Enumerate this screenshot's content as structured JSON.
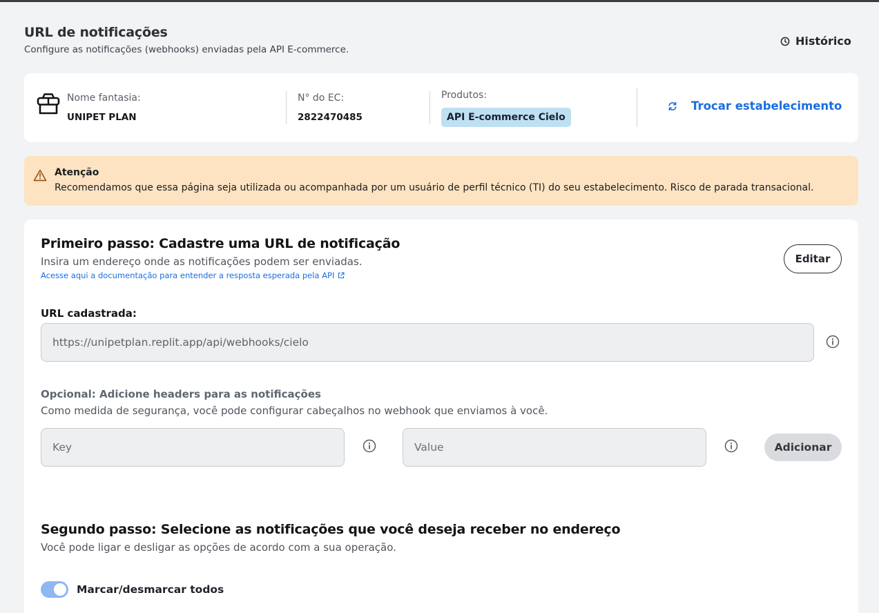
{
  "header": {
    "title": "URL de notificações",
    "subtitle": "Configure as notificações (webhooks) enviadas pela API E-commerce.",
    "history_label": "Histórico"
  },
  "merchant": {
    "trade_name_label": "Nome fantasia:",
    "trade_name_value": "UNIPET PLAN",
    "ec_label": "N° do EC:",
    "ec_value": "2822470485",
    "products_label": "Produtos:",
    "product_badge": "API E-commerce Cielo",
    "switch_label": "Trocar estabelecimento"
  },
  "warning": {
    "title": "Atenção",
    "text": "Recomendamos que essa página seja utilizada ou acompanhada por um usuário de perfil técnico (TI) do seu estabelecimento. Risco de parada transacional."
  },
  "step1": {
    "title": "Primeiro passo: Cadastre uma URL de notificação",
    "description": "Insira um endereço onde as notificações podem ser enviadas.",
    "doc_link": "Acesse aqui a documentação para entender a resposta esperada pela API",
    "edit_label": "Editar",
    "url_label": "URL cadastrada:",
    "url_value": "https://unipetplan.replit.app/api/webhooks/cielo",
    "optional_title": "Opcional: Adicione headers para as notificações",
    "optional_desc": "Como medida de segurança, você pode configurar cabeçalhos no webhook que enviamos à você.",
    "key_placeholder": "Key",
    "value_placeholder": "Value",
    "add_label": "Adicionar"
  },
  "step2": {
    "title": "Segundo passo: Selecione as notificações que você deseja receber no endereço",
    "description": "Você pode ligar e desligar as opções de acordo com a sua operação.",
    "toggle_all_label": "Marcar/desmarcar todos",
    "toggle_all_on": true
  },
  "colors": {
    "link": "#1a6ee0",
    "warning_bg": "#fde3c2",
    "badge_bg": "#bfe0f2",
    "toggle_on": "#8db8f2"
  }
}
